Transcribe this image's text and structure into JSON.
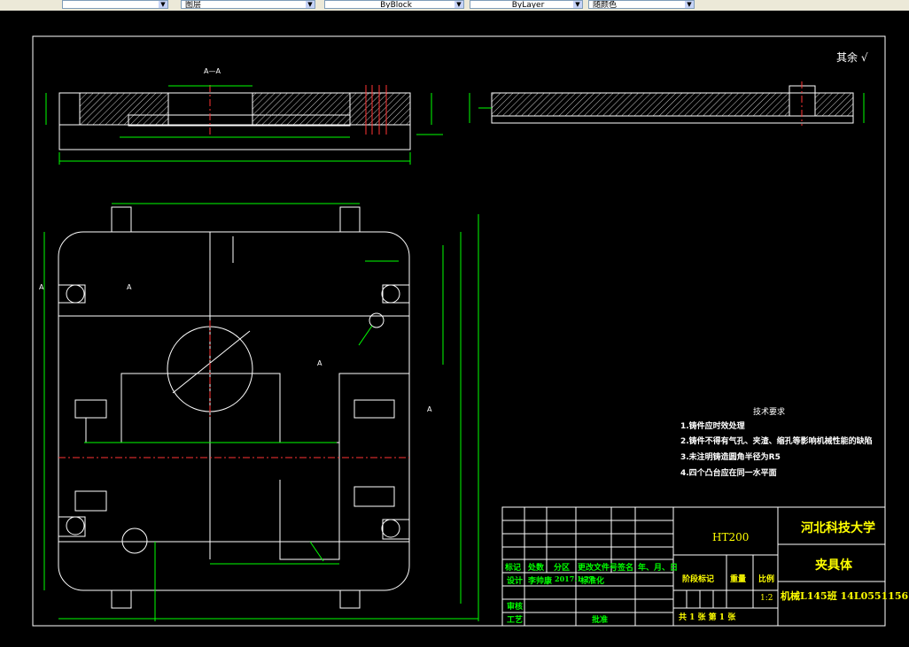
{
  "toolbar": {
    "combo1": "",
    "combo2": "图层",
    "linetype": "ByBlock",
    "lineweight": "ByLayer",
    "plotstyle": "随颜色"
  },
  "drawing": {
    "section_label": "A—A",
    "surface_note": "其余",
    "marker_a": "A",
    "tech": {
      "title": "技术要求",
      "items": [
        "1.铸件应时效处理",
        "2.铸件不得有气孔、夹渣、缩孔等影响机械性能的缺陷",
        "3.未注明铸造圆角半径为R5",
        "4.四个凸台应在同一水平面"
      ]
    }
  },
  "title_block": {
    "material": "HT200",
    "university": "河北科技大学",
    "part_name": "夹具体",
    "class_id": "机械L145班  14L0551156",
    "headers": [
      "标记",
      "处数",
      "分区",
      "更改文件号",
      "签名",
      "年、月、日"
    ],
    "design_label": "设计",
    "designer": "李帅康",
    "design_date": "2017.1.27",
    "standard_label": "标准化",
    "stage_label": "阶段标记",
    "weight_label": "重量",
    "scale_label": "比例",
    "scale": "1:2",
    "review_label": "审核",
    "process_label": "工艺",
    "approve_label": "批准",
    "sheets": "共  1  张      第  1  张"
  },
  "colors": {
    "toolbar": "#ece9d8",
    "canvas": "#000000",
    "line": "#ffffff",
    "dim": "#00ff00",
    "text": "#ffff00"
  }
}
